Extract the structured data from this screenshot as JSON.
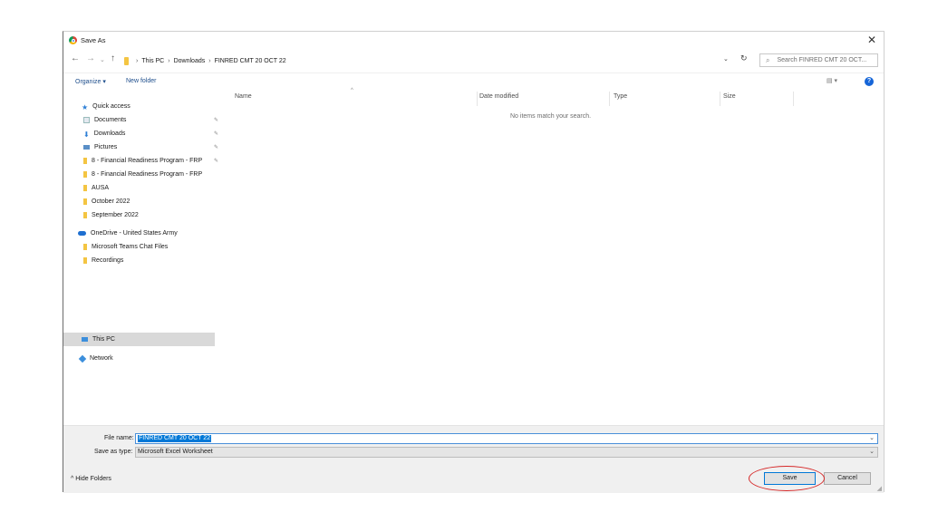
{
  "window": {
    "title": "Save As",
    "close_glyph": "✕"
  },
  "nav": {
    "back_icon": "back-arrow-icon",
    "breadcrumb": [
      "This PC",
      "Downloads",
      "FINRED CMT 20 OCT 22"
    ],
    "search_placeholder": "Search FINRED CMT 20 OCT..."
  },
  "toolbar": {
    "organize_label": "Organize ▾",
    "new_folder_label": "New folder"
  },
  "sidebar": {
    "quick_access": "Quick access",
    "items": [
      {
        "label": "Documents",
        "pinned": true
      },
      {
        "label": "Downloads",
        "pinned": true
      },
      {
        "label": "Pictures",
        "pinned": true
      },
      {
        "label": "8 - Financial Readiness Program - FRP",
        "pinned": true
      },
      {
        "label": "8 - Financial Readiness Program - FRP",
        "pinned": false
      },
      {
        "label": "AUSA",
        "pinned": false
      },
      {
        "label": "October 2022",
        "pinned": false
      },
      {
        "label": "September 2022",
        "pinned": false
      }
    ],
    "onedrive": "OneDrive - United States Army",
    "onedrive_items": [
      "Microsoft Teams Chat Files",
      "Recordings"
    ],
    "this_pc": "This PC",
    "network": "Network"
  },
  "file_list": {
    "columns": [
      "Name",
      "Date modified",
      "Type",
      "Size"
    ],
    "empty_message": "No items match your search."
  },
  "bottom": {
    "file_name_label": "File name:",
    "file_name_value": "FINRED CMT 20 OCT 22",
    "save_as_type_label": "Save as type:",
    "save_as_type_value": "Microsoft Excel Worksheet",
    "hide_folders_label": "Hide Folders",
    "save_label": "Save",
    "cancel_label": "Cancel"
  },
  "colors": {
    "accent": "#0078d7",
    "annotation": "#d62828",
    "folder": "#f4c542"
  }
}
